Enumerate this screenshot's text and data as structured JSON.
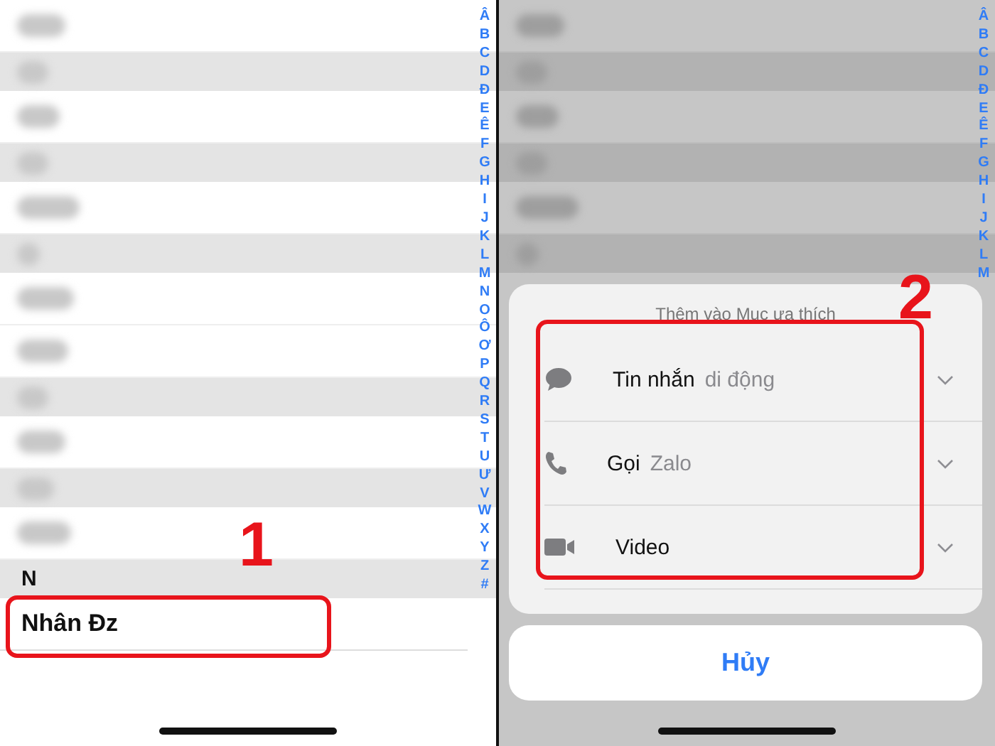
{
  "left": {
    "rows": [
      {
        "kind": "contact"
      },
      {
        "kind": "header"
      },
      {
        "kind": "contact"
      },
      {
        "kind": "header"
      },
      {
        "kind": "contact"
      },
      {
        "kind": "header"
      },
      {
        "kind": "contact"
      },
      {
        "kind": "contact"
      },
      {
        "kind": "header"
      },
      {
        "kind": "contact"
      },
      {
        "kind": "header"
      },
      {
        "kind": "contact"
      }
    ],
    "section": "N",
    "contact": "Nhân Đz",
    "step": "1",
    "index": [
      "Â",
      "B",
      "C",
      "D",
      "Đ",
      "E",
      "Ê",
      "F",
      "G",
      "H",
      "I",
      "J",
      "K",
      "L",
      "M",
      "N",
      "O",
      "Ô",
      "Ơ",
      "P",
      "Q",
      "R",
      "S",
      "T",
      "U",
      "Ư",
      "V",
      "W",
      "X",
      "Y",
      "Z",
      "#"
    ]
  },
  "right": {
    "rows": [
      {
        "kind": "contact"
      },
      {
        "kind": "header"
      },
      {
        "kind": "contact"
      },
      {
        "kind": "header"
      },
      {
        "kind": "contact"
      },
      {
        "kind": "header"
      }
    ],
    "index": [
      "Â",
      "B",
      "C",
      "D",
      "Đ",
      "E",
      "Ê",
      "F",
      "G",
      "H",
      "I",
      "J",
      "K",
      "L",
      "M"
    ],
    "sheet": {
      "title": "Thêm vào Mục ưa thích",
      "options": [
        {
          "kind": "message",
          "label": "Tin nhắn",
          "detail": "di động"
        },
        {
          "kind": "phone",
          "label": "Gọi",
          "detail": "Zalo"
        },
        {
          "kind": "video",
          "label": "Video"
        }
      ]
    },
    "cancel": "Hủy",
    "step": "2"
  }
}
